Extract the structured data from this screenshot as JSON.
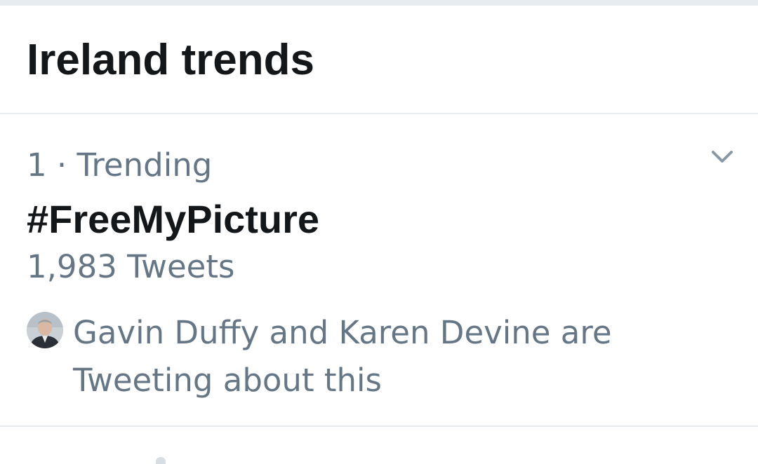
{
  "section": {
    "title": "Ireland trends"
  },
  "trends": [
    {
      "meta": "1 · Trending",
      "name": "#FreeMyPicture",
      "tweet_count": "1,983 Tweets",
      "context_line1": "Gavin Duffy and Karen Devine are",
      "context_line2": "Tweeting about this",
      "menu_icon": "chevron-down-icon"
    }
  ],
  "colors": {
    "primary_text": "#14171a",
    "secondary_text": "#657786",
    "divider": "#e6ecf0",
    "chevron": "#8899a6"
  }
}
